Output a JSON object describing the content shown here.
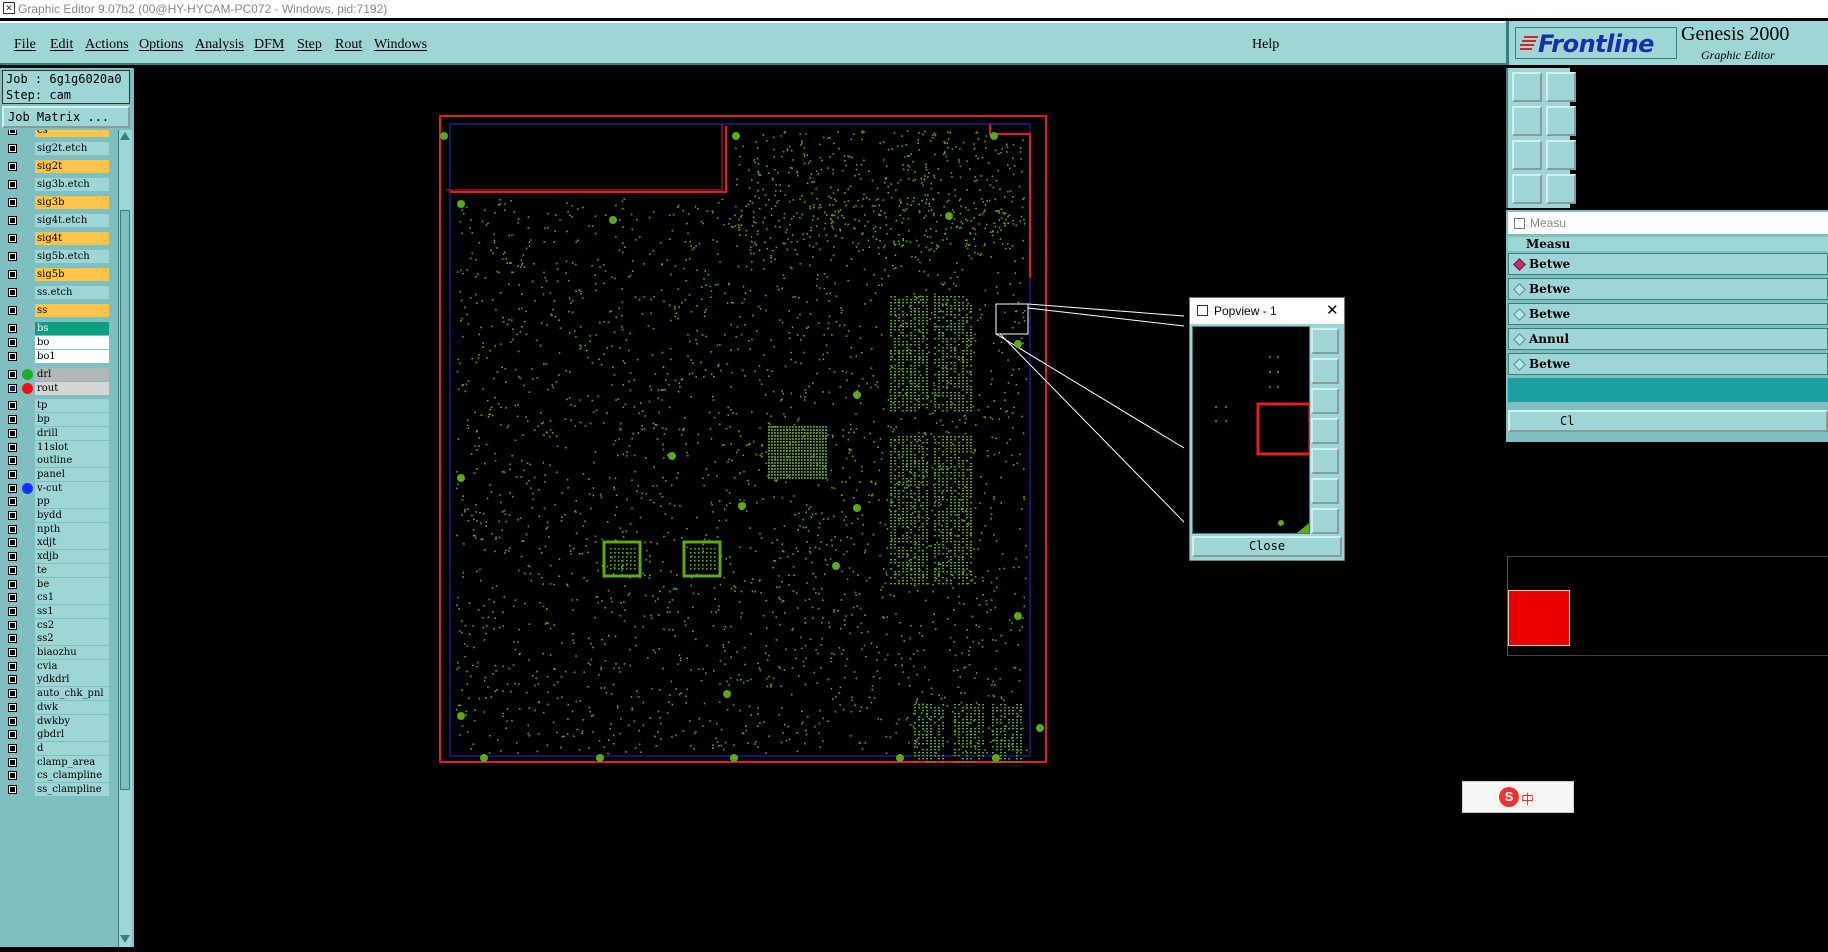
{
  "window": {
    "title": "Graphic Editor 9.07b2 (00@HY-HYCAM-PC072 - Windows, pid:7192)"
  },
  "menubar": {
    "items": [
      "File",
      "Edit",
      "Actions",
      "Options",
      "Analysis",
      "DFM",
      "Step",
      "Rout",
      "Windows"
    ],
    "help": "Help"
  },
  "brand": {
    "logo_text": "Frontline",
    "product": "Genesis 2000",
    "subtitle": "Graphic Editor"
  },
  "job": {
    "job_label": "Job : 6g1g6020a0",
    "step_label": "Step: cam",
    "matrix_button": "Job Matrix ..."
  },
  "layers": [
    {
      "name": "cs",
      "bg": "#ffc44a"
    },
    {
      "name": "sig2t.etch",
      "bg": "#9ed6d6"
    },
    {
      "name": "sig2t",
      "bg": "#ffc44a"
    },
    {
      "name": "sig3b.etch",
      "bg": "#9ed6d6"
    },
    {
      "name": "sig3b",
      "bg": "#ffc44a"
    },
    {
      "name": "sig4t.etch",
      "bg": "#9ed6d6"
    },
    {
      "name": "sig4t",
      "bg": "#ffc44a"
    },
    {
      "name": "sig5b.etch",
      "bg": "#9ed6d6"
    },
    {
      "name": "sig5b",
      "bg": "#ffc44a"
    },
    {
      "name": "ss.etch",
      "bg": "#9ed6d6"
    },
    {
      "name": "ss",
      "bg": "#ffc44a"
    },
    {
      "name": "bs",
      "bg": "#0aa080",
      "color": "#ffffff"
    },
    {
      "name": "bo",
      "bg": "#ffffff"
    },
    {
      "name": "bo1",
      "bg": "#ffffff"
    },
    {
      "name": "drl",
      "bg": "#b0b8b8",
      "dot": "#22aa22"
    },
    {
      "name": "rout",
      "bg": "#d6d6d6",
      "dot": "#ee1111",
      "active": true
    },
    {
      "name": "tp",
      "bg": "#9ed6d6"
    },
    {
      "name": "bp",
      "bg": "#9ed6d6"
    },
    {
      "name": "drill",
      "bg": "#9ed6d6"
    },
    {
      "name": "11slot",
      "bg": "#9ed6d6"
    },
    {
      "name": "outline",
      "bg": "#9ed6d6"
    },
    {
      "name": "panel",
      "bg": "#9ed6d6"
    },
    {
      "name": "v-cut",
      "bg": "#9ed6d6",
      "dot": "#1133ff"
    },
    {
      "name": "pp",
      "bg": "#9ed6d6"
    },
    {
      "name": "bydd",
      "bg": "#9ed6d6"
    },
    {
      "name": "npth",
      "bg": "#9ed6d6"
    },
    {
      "name": "xdjt",
      "bg": "#9ed6d6"
    },
    {
      "name": "xdjb",
      "bg": "#9ed6d6"
    },
    {
      "name": "te",
      "bg": "#9ed6d6"
    },
    {
      "name": "be",
      "bg": "#9ed6d6"
    },
    {
      "name": "cs1",
      "bg": "#9ed6d6"
    },
    {
      "name": "ss1",
      "bg": "#9ed6d6"
    },
    {
      "name": "cs2",
      "bg": "#9ed6d6"
    },
    {
      "name": "ss2",
      "bg": "#9ed6d6"
    },
    {
      "name": "biaozhu",
      "bg": "#9ed6d6"
    },
    {
      "name": "cvia",
      "bg": "#9ed6d6"
    },
    {
      "name": "ydkdrl",
      "bg": "#9ed6d6"
    },
    {
      "name": "auto_chk_pnl",
      "bg": "#9ed6d6"
    },
    {
      "name": "dwk",
      "bg": "#9ed6d6"
    },
    {
      "name": "dwkby",
      "bg": "#9ed6d6"
    },
    {
      "name": "gbdrl",
      "bg": "#9ed6d6"
    },
    {
      "name": "d",
      "bg": "#9ed6d6"
    },
    {
      "name": "clamp_area",
      "bg": "#9ed6d6"
    },
    {
      "name": "cs_clampline",
      "bg": "#9ed6d6"
    },
    {
      "name": "ss_clampline",
      "bg": "#9ed6d6"
    }
  ],
  "popview": {
    "title": "Popview - 1",
    "close_label": "Close"
  },
  "measure": {
    "title": "Measu",
    "heading": "Measu",
    "options": [
      "Betwe",
      "Betwe",
      "Betwe",
      "Annul",
      "Betwe"
    ],
    "close_label": "Cl"
  },
  "ime": {
    "mode": "中"
  },
  "colors": {
    "panel": "#9ed6d6",
    "trace": "#5ea820",
    "outline_red": "#e02020",
    "outline_blue": "#2030c0"
  }
}
